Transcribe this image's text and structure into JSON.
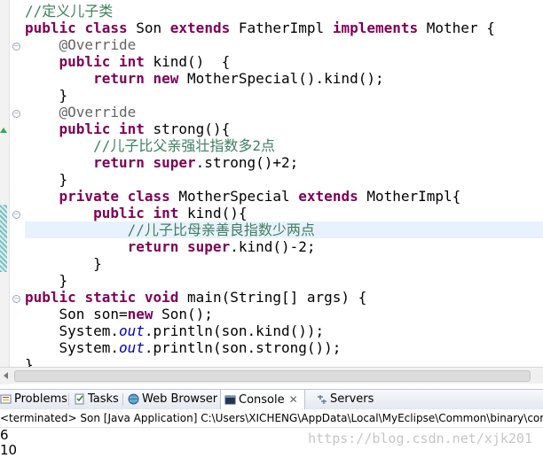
{
  "editor": {
    "lines": [
      [
        {
          "t": "//定义儿子类",
          "c": "cm"
        }
      ],
      [
        {
          "t": "public",
          "c": "kw"
        },
        {
          "t": " "
        },
        {
          "t": "class",
          "c": "kw"
        },
        {
          "t": " Son "
        },
        {
          "t": "extends",
          "c": "kw"
        },
        {
          "t": " FatherImpl "
        },
        {
          "t": "implements",
          "c": "kw"
        },
        {
          "t": " Mother {"
        }
      ],
      [
        {
          "t": "    "
        },
        {
          "t": "@Override",
          "c": "an"
        }
      ],
      [
        {
          "t": "    "
        },
        {
          "t": "public",
          "c": "kw"
        },
        {
          "t": " "
        },
        {
          "t": "int",
          "c": "kw"
        },
        {
          "t": " kind()  {"
        }
      ],
      [
        {
          "t": "        "
        },
        {
          "t": "return",
          "c": "kw"
        },
        {
          "t": " "
        },
        {
          "t": "new",
          "c": "kw"
        },
        {
          "t": " MotherSpecial().kind();"
        }
      ],
      [
        {
          "t": "    }"
        }
      ],
      [
        {
          "t": "    "
        },
        {
          "t": "@Override",
          "c": "an"
        }
      ],
      [
        {
          "t": "    "
        },
        {
          "t": "public",
          "c": "kw"
        },
        {
          "t": " "
        },
        {
          "t": "int",
          "c": "kw"
        },
        {
          "t": " strong(){"
        }
      ],
      [
        {
          "t": "        "
        },
        {
          "t": "//儿子比父亲强壮指数多2点",
          "c": "cm"
        }
      ],
      [
        {
          "t": "        "
        },
        {
          "t": "return",
          "c": "kw"
        },
        {
          "t": " "
        },
        {
          "t": "super",
          "c": "kw"
        },
        {
          "t": ".strong()+2;"
        }
      ],
      [
        {
          "t": "    }"
        }
      ],
      [
        {
          "t": "    "
        },
        {
          "t": "private",
          "c": "kw"
        },
        {
          "t": " "
        },
        {
          "t": "class",
          "c": "kw"
        },
        {
          "t": " MotherSpecial "
        },
        {
          "t": "extends",
          "c": "kw"
        },
        {
          "t": " MotherImpl{"
        }
      ],
      [
        {
          "t": "        "
        },
        {
          "t": "public",
          "c": "kw"
        },
        {
          "t": " "
        },
        {
          "t": "int",
          "c": "kw"
        },
        {
          "t": " kind(){"
        }
      ],
      [
        {
          "t": "            "
        },
        {
          "t": "//儿子比母亲善良指数少两点",
          "c": "cm"
        }
      ],
      [
        {
          "t": "            "
        },
        {
          "t": "return",
          "c": "kw"
        },
        {
          "t": " "
        },
        {
          "t": "super",
          "c": "kw"
        },
        {
          "t": ".kind()-2;"
        }
      ],
      [
        {
          "t": "        }"
        }
      ],
      [
        {
          "t": "    }"
        }
      ],
      [
        {
          "t": "public",
          "c": "kw"
        },
        {
          "t": " "
        },
        {
          "t": "static",
          "c": "kw"
        },
        {
          "t": " "
        },
        {
          "t": "void",
          "c": "kw"
        },
        {
          "t": " main(String[] args) {"
        }
      ],
      [
        {
          "t": "    Son son="
        },
        {
          "t": "new",
          "c": "kw"
        },
        {
          "t": " Son();"
        }
      ],
      [
        {
          "t": "    System."
        },
        {
          "t": "out",
          "c": "it"
        },
        {
          "t": ".println(son.kind());"
        }
      ],
      [
        {
          "t": "    System."
        },
        {
          "t": "out",
          "c": "it"
        },
        {
          "t": ".println(son.strong());"
        }
      ],
      [
        {
          "t": "}"
        }
      ]
    ]
  },
  "tabs": [
    {
      "label": "Problems",
      "icon": "problems-icon"
    },
    {
      "label": "Tasks",
      "icon": "tasks-icon"
    },
    {
      "label": "Web Browser",
      "icon": "globe-icon"
    },
    {
      "label": "Console",
      "icon": "console-icon",
      "active": true
    },
    {
      "label": "Servers",
      "icon": "servers-icon"
    }
  ],
  "console": {
    "header": "<terminated> Son [Java Application] C:\\Users\\XICHENG\\AppData\\Local\\MyEclipse\\Common\\binary\\com.s",
    "output": [
      "6",
      "10"
    ]
  },
  "watermark": "https://blog.csdn.net/xjk201",
  "colors": {
    "keyword": "#7f0055",
    "comment": "#3f7f5f",
    "annotation": "#646464",
    "field": "#0000c0",
    "current_line": "#e8f2fe"
  }
}
